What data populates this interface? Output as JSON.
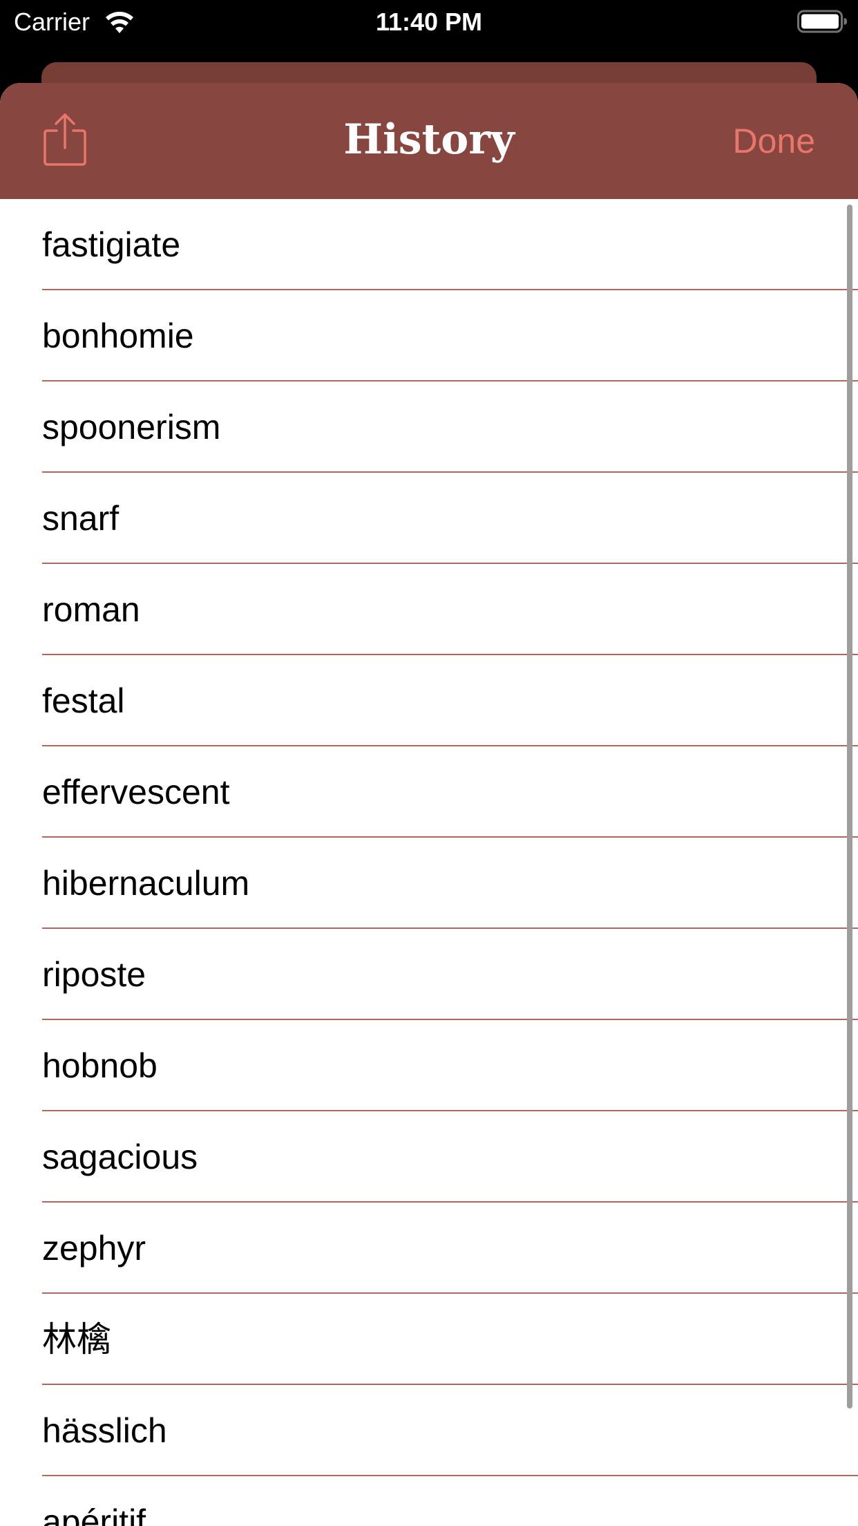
{
  "status_bar": {
    "carrier": "Carrier",
    "time": "11:40 PM"
  },
  "nav": {
    "title": "History",
    "done_label": "Done",
    "share_icon": "share-icon"
  },
  "colors": {
    "nav_background": "#874640",
    "accent": "#e8766a",
    "separator": "#b0675f"
  },
  "history": [
    "fastigiate",
    "bonhomie",
    "spoonerism",
    "snarf",
    "roman",
    "festal",
    "effervescent",
    "hibernaculum",
    "riposte",
    "hobnob",
    "sagacious",
    "zephyr",
    "林檎",
    "hässlich",
    "apéritif"
  ]
}
